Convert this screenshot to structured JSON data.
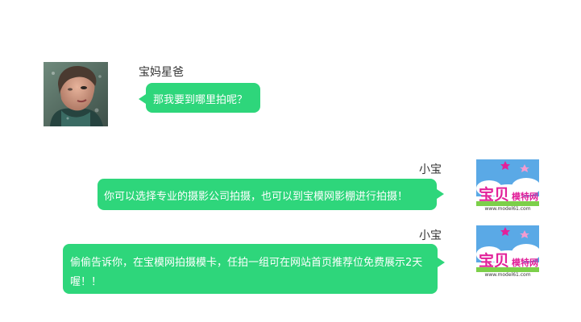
{
  "messages": [
    {
      "sender": "宝妈星爸",
      "side": "left",
      "text": "那我要到哪里拍呢？",
      "avatar": "user-portrait-photo"
    },
    {
      "sender": "小宝",
      "side": "right",
      "text": "你可以选择专业的摄影公司拍摄，也可以到宝模网影棚进行拍摄！",
      "avatar": "baobei-model-logo"
    },
    {
      "sender": "小宝",
      "side": "right",
      "text": "偷偷告诉你，在宝模网拍摄模卡，任拍一组可在网站首页推荐位免费展示2天喔！！",
      "avatar": "baobei-model-logo"
    }
  ],
  "logo": {
    "main_text": "宝贝",
    "sub_text": "模特网",
    "url_text": "www.model61.com"
  },
  "colors": {
    "bubble": "#2ed67b",
    "bubble_text": "#ffffff",
    "name_text": "#333333",
    "background": "#ffffff",
    "logo_pink": "#e2219a",
    "logo_sky": "#5aa9e6"
  }
}
